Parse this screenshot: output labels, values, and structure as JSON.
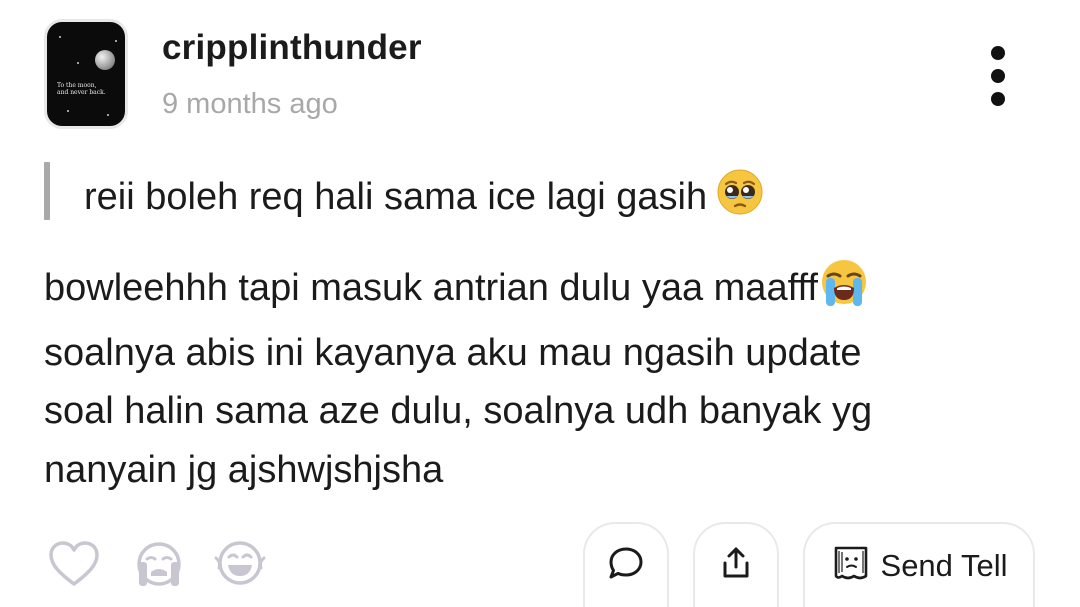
{
  "post": {
    "author": {
      "username": "cripplinthunder",
      "avatar_caption": "To the moon,\nand never back."
    },
    "timestamp": "9 months ago",
    "question": {
      "text": "reii boleh req hali sama ice lagi gasih",
      "emoji": "pleading-face-icon"
    },
    "answer": {
      "lines": [
        "bowleehhh tapi masuk antrian dulu yaa maafff",
        "soalnya abis ini kayanya aku mau ngasih update",
        "soal halin sama aze dulu, soalnya udh banyak yg",
        "nanyain jg ajshwjshjsha"
      ],
      "emoji": "loudly-crying-face-icon"
    }
  },
  "actions": {
    "reactions": [
      "heart-icon",
      "crying-reaction-icon",
      "laughing-reaction-icon"
    ],
    "comment_icon": "comment-icon",
    "share_icon": "share-icon",
    "send_tell_label": "Send Tell",
    "send_tell_icon": "tell-icon"
  },
  "colors": {
    "text": "#1b1b1b",
    "muted": "#a8a8a8",
    "icon_outline": "#c9c6d2",
    "border": "#e9e9e9",
    "emoji_yellow": "#f7c641"
  }
}
